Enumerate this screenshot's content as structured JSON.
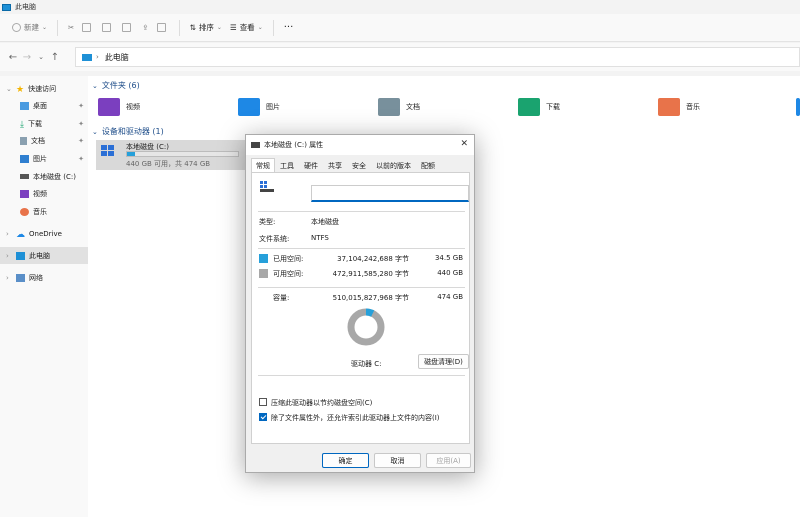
{
  "window": {
    "title": "此电脑"
  },
  "toolbar": {
    "new_label": "新建",
    "sort_label": "排序",
    "view_label": "查看",
    "more_label": "···"
  },
  "address": {
    "path": "此电脑"
  },
  "sidebar": {
    "items": [
      {
        "label": "快速访问"
      },
      {
        "label": "桌面"
      },
      {
        "label": "下载"
      },
      {
        "label": "文档"
      },
      {
        "label": "图片"
      },
      {
        "label": "本地磁盘 (C:)"
      },
      {
        "label": "视频"
      },
      {
        "label": "音乐"
      },
      {
        "label": "OneDrive"
      },
      {
        "label": "此电脑"
      },
      {
        "label": "网络"
      }
    ]
  },
  "main": {
    "folders_header": "文件夹 (6)",
    "folders": [
      {
        "label": "视频",
        "color": "#7b3fbf"
      },
      {
        "label": "图片",
        "color": "#1e88e5"
      },
      {
        "label": "文档",
        "color": "#78909c"
      },
      {
        "label": "下载",
        "color": "#1aa36f"
      },
      {
        "label": "音乐",
        "color": "#e8734a"
      }
    ],
    "devices_header": "设备和驱动器 (1)",
    "drive": {
      "name": "本地磁盘 (C:)",
      "size_text": "440 GB 可用，共 474 GB",
      "used_fraction": 0.073
    }
  },
  "dialog": {
    "title": "本地磁盘 (C:) 属性",
    "tabs": [
      "常规",
      "工具",
      "硬件",
      "共享",
      "安全",
      "以前的版本",
      "配额"
    ],
    "type_label": "类型:",
    "type_value": "本地磁盘",
    "fs_label": "文件系统:",
    "fs_value": "NTFS",
    "used_label": "已用空间:",
    "used_bytes": "37,104,242,688 字节",
    "used_gb": "34.5 GB",
    "free_label": "可用空间:",
    "free_bytes": "472,911,585,280 字节",
    "free_gb": "440 GB",
    "cap_label": "容量:",
    "cap_bytes": "510,015,827,968 字节",
    "cap_gb": "474 GB",
    "drive_label": "驱动器 C:",
    "cleanup_label": "磁盘清理(D)",
    "compress_label": "压缩此驱动器以节约磁盘空间(C)",
    "index_label": "除了文件属性外，还允许索引此驱动器上文件的内容(I)",
    "ok_label": "确定",
    "cancel_label": "取消",
    "apply_label": "应用(A)",
    "used_color": "#26a0da",
    "free_color": "#a8a8a8",
    "used_fraction": 0.073
  }
}
